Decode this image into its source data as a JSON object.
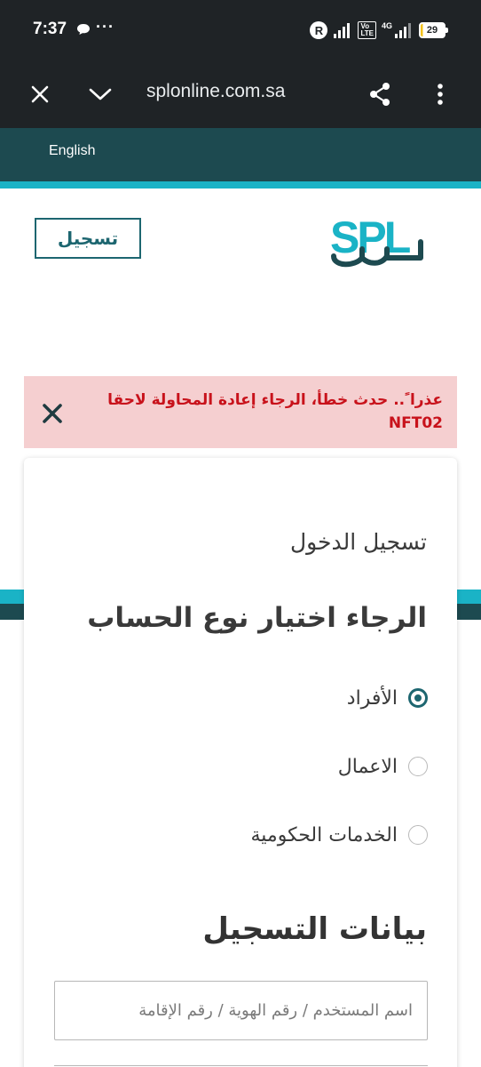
{
  "status_bar": {
    "time": "7:37",
    "more": "···",
    "r_badge": "R",
    "volte_top": "Vo",
    "volte_bottom": "LTE",
    "network": "4G",
    "battery": "29"
  },
  "browser": {
    "url": "splonline.com.sa",
    "close_icon": "close-icon",
    "dropdown_icon": "chevron-down-icon",
    "share_icon": "share-icon",
    "menu_icon": "more-vert-icon"
  },
  "header": {
    "language_link": "English",
    "register_button": "تسجيل",
    "logo_text": "SPL"
  },
  "alert": {
    "message": "عذرا ً.. حدث خطأ، الرجاء إعادة المحاولة لاحقا NFT02"
  },
  "login": {
    "title": "تسجيل الدخول",
    "account_type_title": "الرجاء اختيار نوع الحساب",
    "account_types": [
      {
        "label": "الأفراد",
        "selected": true
      },
      {
        "label": "الاعمال",
        "selected": false
      },
      {
        "label": "الخدمات الحكومية",
        "selected": false
      }
    ],
    "registration_title": "بيانات التسجيل",
    "id_placeholder": "اسم المستخدم / رقم الهوية / رقم الإقامة"
  },
  "colors": {
    "brand_teal": "#1d6670",
    "brand_dark": "#1d4a50",
    "accent_cyan": "#1ab3c6",
    "error_red": "#c8121b",
    "error_bg": "#f5cfd0"
  }
}
